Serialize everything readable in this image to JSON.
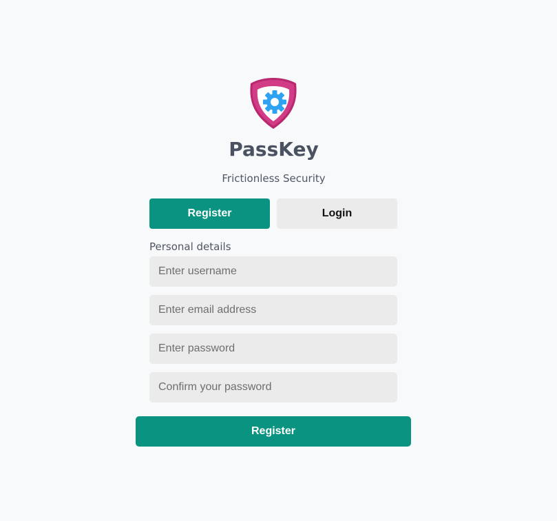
{
  "brand": {
    "logo_icon": "shield-gear-icon",
    "title": "PassKey",
    "tagline": "Frictionless Security"
  },
  "tabs": [
    {
      "label": "Register",
      "active": true
    },
    {
      "label": "Login",
      "active": false
    }
  ],
  "form": {
    "section_label": "Personal details",
    "fields": [
      {
        "placeholder": "Enter username",
        "value": ""
      },
      {
        "placeholder": "Enter email address",
        "value": ""
      },
      {
        "placeholder": "Enter password",
        "value": ""
      },
      {
        "placeholder": "Confirm your password",
        "value": ""
      }
    ],
    "submit_label": "Register"
  },
  "colors": {
    "accent": "#0a9381",
    "shield": "#c8327e",
    "gear": "#2ea3f2",
    "background": "#f8f9fb"
  }
}
